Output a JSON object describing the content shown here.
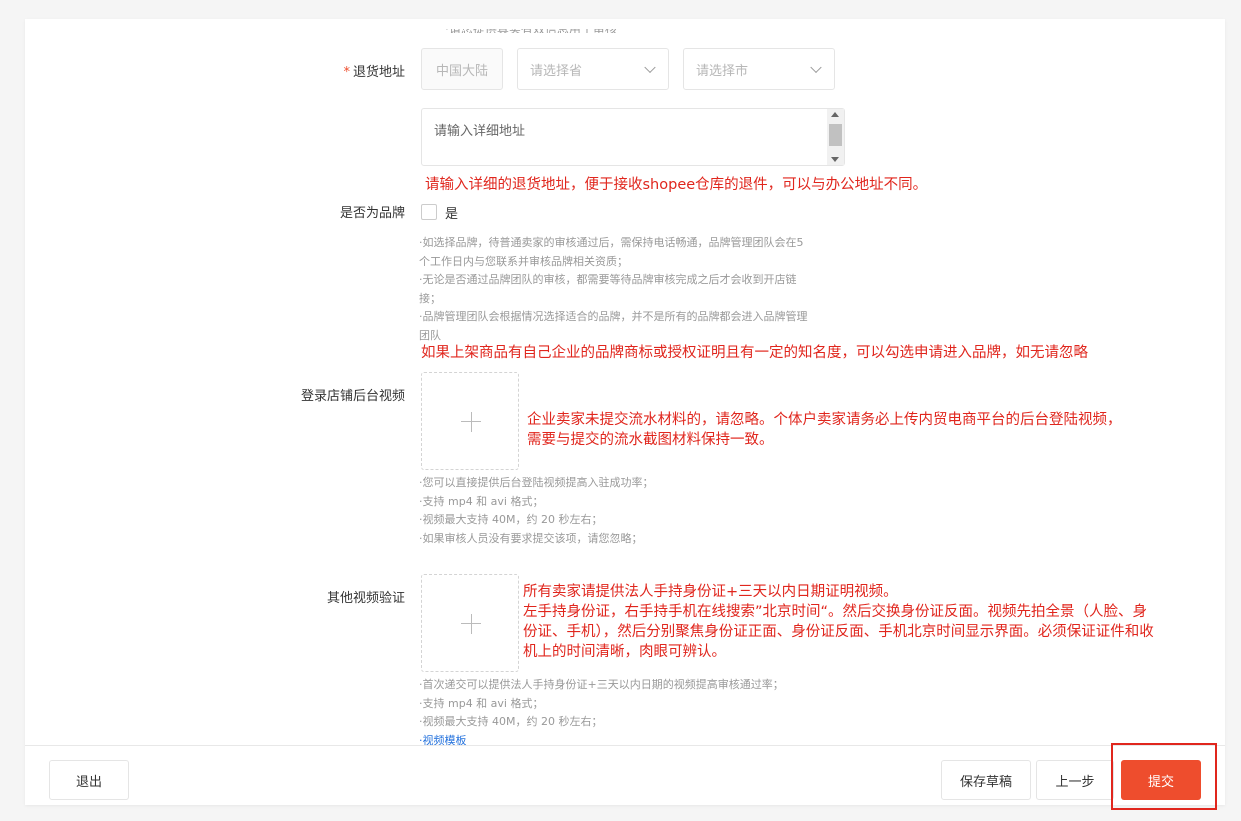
{
  "return_address": {
    "label": "退货地址",
    "required_mark": "*",
    "country_value": "中国大陆",
    "province_placeholder": "请选择省",
    "city_placeholder": "请选择市",
    "detail_placeholder": "请输入详细地址",
    "annotation": "请输入详细的退货地址，便于接收shopee仓库的退件，可以与办公地址不同。"
  },
  "brand": {
    "label": "是否为品牌",
    "checkbox_label": "是",
    "hints": [
      "·如选择品牌，待普通卖家的审核通过后，需保持电话畅通，品牌管理团队会在5",
      "个工作日内与您联系并审核品牌相关资质；",
      "·无论是否通过品牌团队的审核，都需要等待品牌审核完成之后才会收到开店链",
      "接；",
      "·品牌管理团队会根据情况选择适合的品牌，并不是所有的品牌都会进入品牌管理",
      "团队"
    ],
    "annotation": "如果上架商品有自己企业的品牌商标或授权证明且有一定的知名度，可以勾选申请进入品牌，如无请忽略"
  },
  "store_video": {
    "label": "登录店铺后台视频",
    "annotation_lines": [
      "企业卖家未提交流水材料的，请忽略。个体户卖家请务必上传内贸电商平台的后台登陆视频，",
      "需要与提交的流水截图材料保持一致。"
    ],
    "hints": [
      "·您可以直接提供后台登陆视频提高入驻成功率；",
      "·支持 mp4 和 avi 格式；",
      "·视频最大支持 40M，约 20 秒左右；",
      "·如果审核人员没有要求提交该项，请您忽略；"
    ]
  },
  "other_video": {
    "label": "其他视频验证",
    "annotation_lines": [
      "所有卖家请提供法人手持身份证+三天以内日期证明视频。",
      "左手持身份证，右手持手机在线搜索”北京时间“。然后交换身份证反面。视频先拍全景（人脸、身",
      "份证、手机），然后分别聚焦身份证正面、身份证反面、手机北京时间显示界面。必须保证证件和收",
      "机上的时间清晰，肉眼可辨认。"
    ],
    "hints": [
      "·首次递交可以提供法人手持身份证+三天以内日期的视频提高审核通过率；",
      "·支持 mp4 和 avi 格式；",
      "·视频最大支持 40M，约 20 秒左右；"
    ],
    "template_link": "·视频模板"
  },
  "footer": {
    "exit_label": "退出",
    "save_draft_label": "保存草稿",
    "prev_label": "上一步",
    "submit_label": "提交"
  },
  "colors": {
    "accent": "#ee4d2d",
    "annotation_red": "#e0261d",
    "highlight_border": "#e0261d",
    "link": "#2673dd"
  }
}
